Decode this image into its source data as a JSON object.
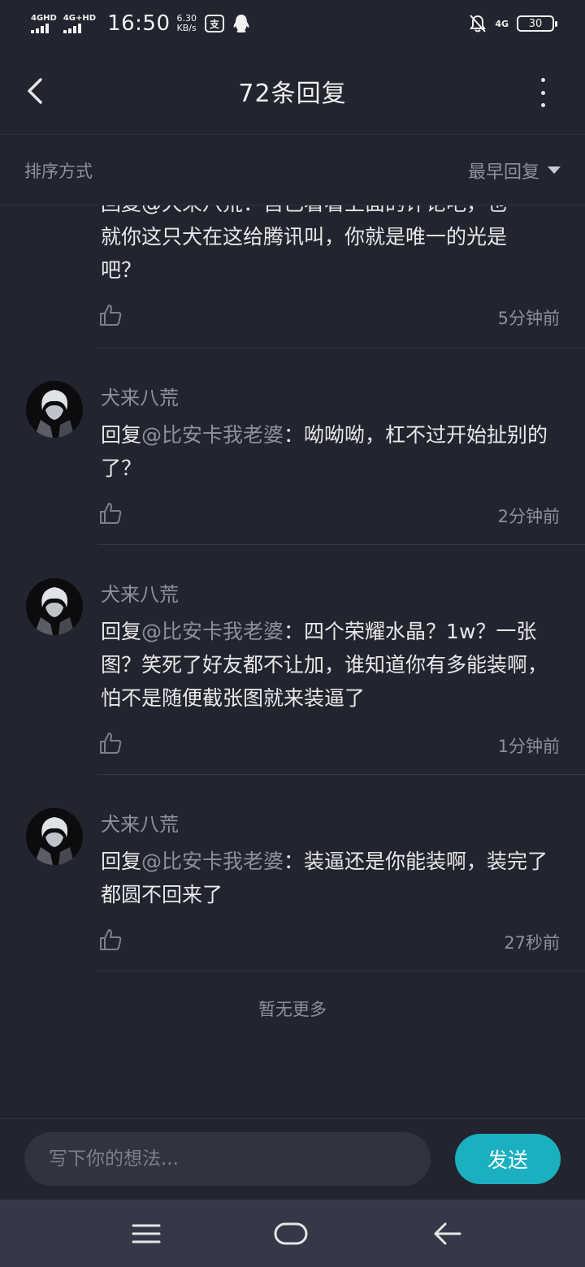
{
  "status_bar": {
    "sim1": "4GHD",
    "sim2": "4G+HD",
    "time": "16:50",
    "speed_value": "6.30",
    "speed_unit": "KB/s",
    "app_badge": "支",
    "network": "4G",
    "battery": "30",
    "icons": [
      "signal-icon",
      "signal-icon",
      "alipay-icon",
      "qq-icon",
      "mute-bell-icon",
      "battery-icon"
    ]
  },
  "header": {
    "title": "72条回复"
  },
  "sort": {
    "label": "排序方式",
    "selected": "最早回复"
  },
  "comments": [
    {
      "author": "",
      "body_prefix": "回复",
      "mention": "@犬来八荒",
      "body": "：自己看看上面的评论吧，也就你这只犬在这给腾讯叫，你就是唯一的光是吧？",
      "visible_lines": [
        "回复@犬来八荒：自己看看上面的评论吧，也",
        "就你这只犬在这给腾讯叫，你就是唯一的光是",
        "吧？"
      ],
      "time": "5分钟前"
    },
    {
      "author": "犬来八荒",
      "body_prefix": "回复",
      "mention": "@比安卡我老婆",
      "body": "：呦呦呦，杠不过开始扯别的了？",
      "time": "2分钟前"
    },
    {
      "author": "犬来八荒",
      "body_prefix": "回复",
      "mention": "@比安卡我老婆",
      "body": "：四个荣耀水晶？1w？一张图？笑死了好友都不让加，谁知道你有多能装啊，怕不是随便截张图就来装逼了",
      "time": "1分钟前"
    },
    {
      "author": "犬来八荒",
      "body_prefix": "回复",
      "mention": "@比安卡我老婆",
      "body": "：装逼还是你能装啊，装完了都圆不回来了",
      "time": "27秒前"
    }
  ],
  "no_more": "暂无更多",
  "composer": {
    "placeholder": "写下你的想法...",
    "send_label": "发送"
  },
  "colors": {
    "background": "#22242f",
    "accent": "#1ab0c0",
    "muted_text": "#8e919c",
    "nav_bar": "#353846"
  }
}
